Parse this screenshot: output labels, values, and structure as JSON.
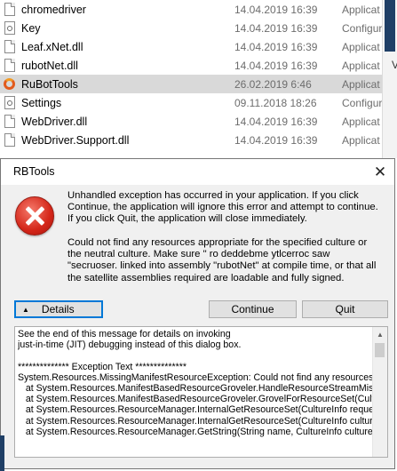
{
  "explorer": {
    "files": [
      {
        "name": "chromedriver",
        "date": "14.04.2019 16:39",
        "type": "Applicat",
        "icon": "application-icon",
        "selected": false
      },
      {
        "name": "Key",
        "date": "14.04.2019 16:39",
        "type": "Configur",
        "icon": "config-file-icon",
        "selected": false
      },
      {
        "name": "Leaf.xNet.dll",
        "date": "14.04.2019 16:39",
        "type": "Applicat",
        "icon": "dll-file-icon",
        "selected": false
      },
      {
        "name": "rubotNet.dll",
        "date": "14.04.2019 16:39",
        "type": "Applicat",
        "icon": "dll-file-icon",
        "selected": false
      },
      {
        "name": "RuBotTools",
        "date": "26.02.2019 6:46",
        "type": "Applicat",
        "icon": "rubottools-app-icon",
        "selected": true
      },
      {
        "name": "Settings",
        "date": "09.11.2018 18:26",
        "type": "Configur",
        "icon": "config-file-icon",
        "selected": false
      },
      {
        "name": "WebDriver.dll",
        "date": "14.04.2019 16:39",
        "type": "Applicat",
        "icon": "dll-file-icon",
        "selected": false
      },
      {
        "name": "WebDriver.Support.dll",
        "date": "14.04.2019 16:39",
        "type": "Applicat",
        "icon": "dll-file-icon",
        "selected": false
      }
    ],
    "side_letter": "V"
  },
  "dialog": {
    "title": "RBTools",
    "close_label": "✕",
    "message1": "Unhandled exception has occurred in your application. If you click Continue, the application will ignore this error and attempt to continue. If you click Quit, the application will close immediately.",
    "message2": "Could not find any resources appropriate for the specified culture or the neutral culture.  Make sure \" ro deddebme ytlcerroc saw \"secruoser. linked into assembly \"rubotNet\" at compile time, or that all the satellite assemblies required are loadable and fully signed.",
    "details_label": "Details",
    "continue_label": "Continue",
    "quit_label": "Quit",
    "details_text": "See the end of this message for details on invoking\njust-in-time (JIT) debugging instead of this dialog box.\n\n************** Exception Text **************\nSystem.Resources.MissingManifestResourceException: Could not find any resources\n   at System.Resources.ManifestBasedResourceGroveler.HandleResourceStreamMis\n   at System.Resources.ManifestBasedResourceGroveler.GrovelForResourceSet(Cult\n   at System.Resources.ResourceManager.InternalGetResourceSet(CultureInfo reque\n   at System.Resources.ResourceManager.InternalGetResourceSet(CultureInfo cultur\n   at System.Resources.ResourceManager.GetString(String name, CultureInfo culture)"
  }
}
